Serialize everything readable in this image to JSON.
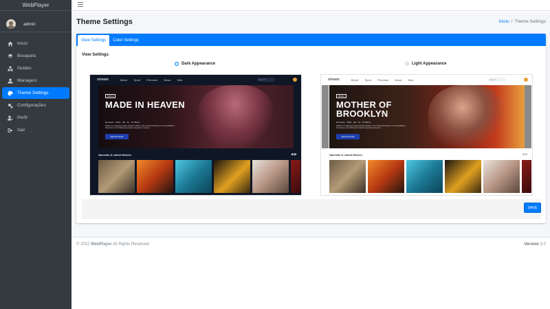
{
  "app": {
    "brand": "WebPlayer"
  },
  "user": {
    "name": "admin"
  },
  "sidebar": {
    "items": [
      {
        "label": "Inicio",
        "icon": "home-icon",
        "active": false
      },
      {
        "label": "Bouquets",
        "icon": "layers-icon",
        "active": false
      },
      {
        "label": "Guides",
        "icon": "boxes-icon",
        "active": false
      },
      {
        "label": "Managers",
        "icon": "user-tie-icon",
        "active": false
      },
      {
        "label": "Theme Settings",
        "icon": "palette-icon",
        "active": true
      },
      {
        "label": "Configurações",
        "icon": "cogs-icon",
        "active": false
      },
      {
        "label": "Perfil",
        "icon": "user-edit-icon",
        "active": false
      },
      {
        "label": "Sair",
        "icon": "sign-out-icon",
        "active": false
      }
    ]
  },
  "header": {
    "title": "Theme Settings",
    "breadcrumb": {
      "home": "Inicio",
      "separator": "/",
      "current": "Theme Settings"
    }
  },
  "tabs": [
    {
      "label": "View Settings",
      "active": true
    },
    {
      "label": "Color Settings",
      "active": false
    }
  ],
  "view_settings": {
    "section_title": "View Settings",
    "options": [
      {
        "label": "Dark Appearance",
        "selected": true
      },
      {
        "label": "Light Appearance",
        "selected": false
      }
    ]
  },
  "previews": {
    "dark": {
      "logo": "stream.",
      "menu": [
        "Movie",
        "Sport",
        "Premium",
        "News",
        "Kids"
      ],
      "search_placeholder": "Search",
      "tag": "BIRCH",
      "title": "MADE IN HEAVEN",
      "meta": "Romance  ·  2024  ·  HD  ·  8+  ·  1h 45min",
      "description": "Redline is a gripping prestige television thriller in the visceral landscape of the grandfathers. Tomorrow is a Fernhill pop sensation desperate to become.",
      "cta": "WATCH NOW",
      "row_title": "Specials & Latest Movies"
    },
    "light": {
      "logo": "stream.",
      "menu": [
        "Movie",
        "Sport",
        "Premium",
        "News",
        "Kids"
      ],
      "search_placeholder": "Search",
      "tag": "BIRCH",
      "title": "MOTHER OF BROOKLYN",
      "meta": "Romance  ·  2024  ·  HD  ·  8+  ·  1h 45min",
      "description": "Redline is a gripping prestige television thriller in the visceral landscape of the grandfathers. Tomorrow is a Fernhill pop sensation desperate to become.",
      "cta": "WATCH NOW",
      "row_title": "Specials & Latest Movies"
    }
  },
  "actions": {
    "save": "SAVE"
  },
  "footer": {
    "copyright_prefix": "© 2022 ",
    "copyright_brand": "WebPlayer",
    "copyright_suffix": " All Rights Reserved.",
    "version_label": "Version",
    "version_value": "3.0"
  },
  "colors": {
    "primary": "#007bff",
    "sidebar_bg": "#343a40",
    "content_bg": "#f4f6f9"
  }
}
